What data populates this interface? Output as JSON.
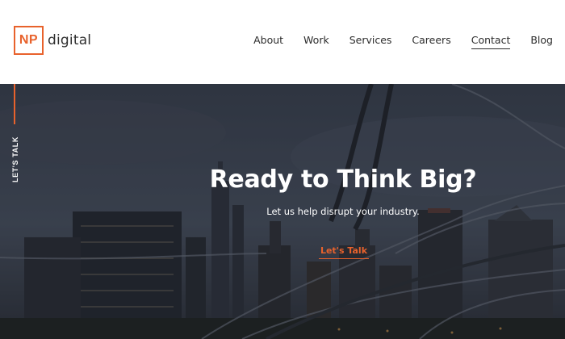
{
  "brand": {
    "mark": "NP",
    "word": "digital",
    "accent": "#e8622c"
  },
  "nav": {
    "items": [
      {
        "label": "About"
      },
      {
        "label": "Work"
      },
      {
        "label": "Services"
      },
      {
        "label": "Careers"
      },
      {
        "label": "Contact",
        "active": true
      },
      {
        "label": "Blog"
      }
    ]
  },
  "hero": {
    "side_label": "LET'S TALK",
    "title": "Ready to Think Big?",
    "subtitle": "Let us help disrupt your industry.",
    "cta": "Let's Talk"
  }
}
